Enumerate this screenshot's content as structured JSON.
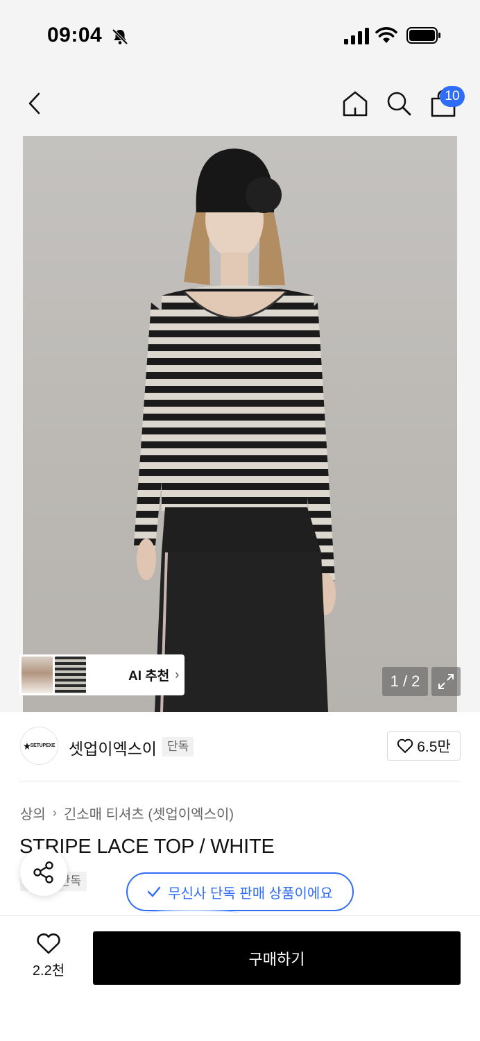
{
  "status_bar": {
    "time": "09:04"
  },
  "header": {
    "cart_count": "10"
  },
  "gallery": {
    "ai_recommend_label": "AI 추천",
    "page_indicator": "1 / 2"
  },
  "brand": {
    "logo_text": "SETUPEXE",
    "name": "셋업이엑스이",
    "tag": "단독",
    "likes": "6.5만"
  },
  "breadcrumb": [
    "상의",
    "긴소매 티셔츠 (셋업이엑스이)"
  ],
  "product": {
    "title": "STRIPE LACE TOP / WHITE",
    "badge": "단독"
  },
  "toast": {
    "text": "무신사 단독 판매 상품이에요"
  },
  "bottom_bar": {
    "wish_count": "2.2천",
    "buy_label": "구매하기"
  },
  "colors": {
    "accent": "#2f6df6",
    "buy_button": "#000000"
  }
}
